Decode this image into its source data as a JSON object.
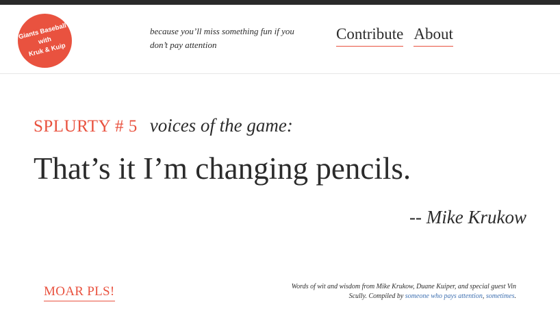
{
  "header": {
    "logo_text": "Giants Baseball\nwith\nKruk & Kuip",
    "tagline": "because you’ll miss something fun if you don’t pay attention",
    "nav": {
      "contribute_label": "Contribute",
      "about_label": "About"
    }
  },
  "main": {
    "splurty_label": "SPLURTY # 5",
    "voices_label": "voices of the game:",
    "quote": "That’s it I’m changing pencils.",
    "author": "-- Mike Krukow"
  },
  "footer": {
    "moar_label": "MOAR PLS!",
    "note_text": "Words of wit and wisdom from Mike Krukow, Duane Kuiper, and special guest Vin Scully. Compiled by",
    "link_1_text": "someone who pays attention",
    "link_separator": ",",
    "link_2_text": "sometimes",
    "note_end": "."
  },
  "colors": {
    "accent": "#e9523f",
    "text": "#2b2b2b",
    "link": "#3d6fb0",
    "topbar": "#2a2a2a"
  }
}
